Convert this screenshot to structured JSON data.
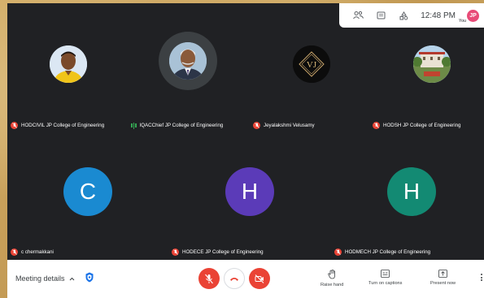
{
  "topbar": {
    "time": "12:48 PM",
    "you_label": "You",
    "you_initials": "JP",
    "icons": [
      "people-icon",
      "chat-icon",
      "activities-icon"
    ]
  },
  "participants": [
    {
      "name": "HODCIVIL JP College of Engineering",
      "avatar": "photo-man-yellow-shirt",
      "mic": "muted"
    },
    {
      "name": "IQACChief JP College of Engineering",
      "avatar": "photo-man-suit",
      "mic": "speaking"
    },
    {
      "name": "Jeyalakshmi Velusamy",
      "avatar": "logo-vj",
      "logo_text": "VJ",
      "mic": "muted"
    },
    {
      "name": "HODSH JP College of Engineering",
      "avatar": "photo-building",
      "mic": "muted"
    },
    {
      "name": "c chermakkani",
      "avatar": "letter",
      "letter": "C",
      "color": "#1a8ad1",
      "mic": "muted"
    },
    {
      "name": "HODECE JP College of Engineering",
      "avatar": "letter",
      "letter": "H",
      "color": "#5b3bb8",
      "mic": "muted"
    },
    {
      "name": "HODMECH JP College of Engineering",
      "avatar": "letter",
      "letter": "H",
      "color": "#138a73",
      "mic": "muted"
    }
  ],
  "bottombar": {
    "meeting_details_label": "Meeting details",
    "raise_hand_label": "Raise hand",
    "captions_label": "Turn on captions",
    "present_label": "Present now"
  },
  "colors": {
    "meet_background": "#202124",
    "danger": "#ea4335",
    "speaking": "#34a853"
  }
}
